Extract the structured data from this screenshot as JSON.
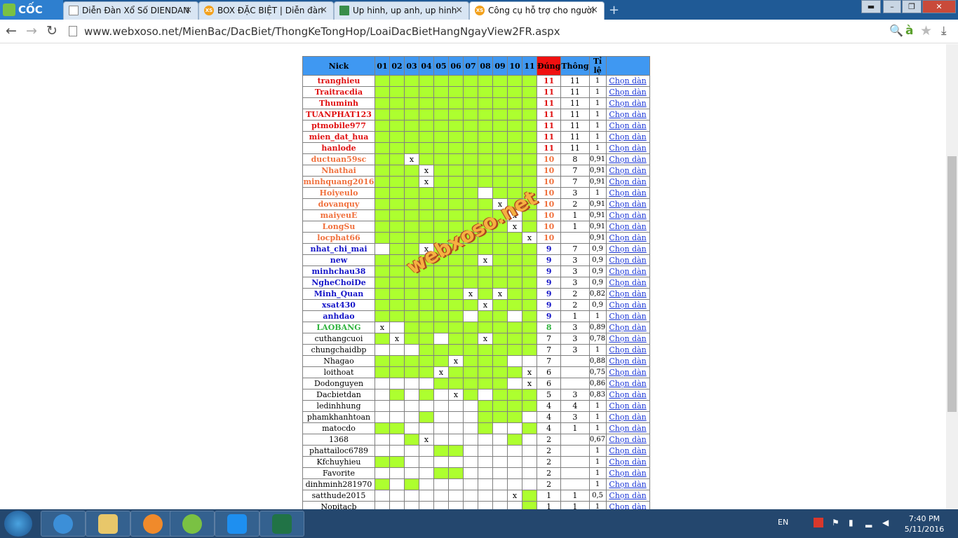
{
  "browser": {
    "logo": "CỐC CỐC",
    "tabs": [
      {
        "label": "Diễn Đàn Xổ Số DIENDAN",
        "icon": "document-icon"
      },
      {
        "label": "BOX ĐẶC BIỆT | Diễn đàn",
        "icon": "xs-icon",
        "icon_text": "XS"
      },
      {
        "label": "Up hinh, up anh, up hinh",
        "icon": "image-icon"
      },
      {
        "label": "Công cụ hỗ trợ cho người",
        "icon": "xs-icon",
        "icon_text": "XS",
        "active": true
      }
    ],
    "url": "www.webxoso.net/MienBac/DacBiet/ThongKeTongHop/LoaiDacBietHangNgayView2FR.aspx"
  },
  "table": {
    "headers": {
      "nick": "Nick",
      "days": [
        "01",
        "02",
        "03",
        "04",
        "05",
        "06",
        "07",
        "08",
        "09",
        "10",
        "11"
      ],
      "dung": "Đúng",
      "thong": "Thông",
      "tile": "Tỉ lệ"
    },
    "link_label": "Chọn dàn",
    "rows": [
      {
        "nick": "tranghieu",
        "color": "red",
        "cells": "ggggggggggg",
        "x": [],
        "dung": "11",
        "thong": "11",
        "tile": "1"
      },
      {
        "nick": "Traitracdia",
        "color": "red",
        "cells": "ggggggggggg",
        "x": [],
        "dung": "11",
        "thong": "11",
        "tile": "1"
      },
      {
        "nick": "Thuminh",
        "color": "red",
        "cells": "ggggggggggg",
        "x": [],
        "dung": "11",
        "thong": "11",
        "tile": "1"
      },
      {
        "nick": "TUANPHAT123",
        "color": "red",
        "cells": "ggggggggggg",
        "x": [],
        "dung": "11",
        "thong": "11",
        "tile": "1"
      },
      {
        "nick": "ptmobile977",
        "color": "red",
        "cells": "ggggggggggg",
        "x": [],
        "dung": "11",
        "thong": "11",
        "tile": "1"
      },
      {
        "nick": "mien_dat_hua",
        "color": "red",
        "cells": "ggggggggggg",
        "x": [],
        "dung": "11",
        "thong": "11",
        "tile": "1"
      },
      {
        "nick": "hanlode",
        "color": "red",
        "cells": "ggggggggggg",
        "x": [],
        "dung": "11",
        "thong": "11",
        "tile": "1"
      },
      {
        "nick": "ductuan59sc",
        "color": "orange",
        "cells": "ggwgggggggg",
        "x": [
          3
        ],
        "dung": "10",
        "thong": "8",
        "tile": "0,91"
      },
      {
        "nick": "Nhathai",
        "color": "orange",
        "cells": "gggwggggggg",
        "x": [
          4
        ],
        "dung": "10",
        "thong": "7",
        "tile": "0,91"
      },
      {
        "nick": "minhquang2016",
        "color": "orange",
        "cells": "gggwggggggg",
        "x": [
          4
        ],
        "dung": "10",
        "thong": "7",
        "tile": "0,91"
      },
      {
        "nick": "Hoiyeulo",
        "color": "orange",
        "cells": "gggggggwggg",
        "x": [],
        "dung": "10",
        "thong": "3",
        "tile": "1"
      },
      {
        "nick": "dovanquy",
        "color": "orange",
        "cells": "ggggggggwgg",
        "x": [
          9
        ],
        "dung": "10",
        "thong": "2",
        "tile": "0,91"
      },
      {
        "nick": "maiyeuE",
        "color": "orange",
        "cells": "gggggggggwg",
        "x": [
          10
        ],
        "dung": "10",
        "thong": "1",
        "tile": "0,91"
      },
      {
        "nick": "LongSu",
        "color": "orange",
        "cells": "gggggggggwg",
        "x": [
          10
        ],
        "dung": "10",
        "thong": "1",
        "tile": "0,91"
      },
      {
        "nick": "locphat66",
        "color": "orange",
        "cells": "ggggggggggw",
        "x": [
          11
        ],
        "dung": "10",
        "thong": "",
        "tile": "0,91"
      },
      {
        "nick": "nhat_chi_mai",
        "color": "blue",
        "cells": "wggwggggggg",
        "x": [
          4
        ],
        "dung": "9",
        "thong": "7",
        "tile": "0,9"
      },
      {
        "nick": "new",
        "color": "blue",
        "cells": "gggggggwggg",
        "x": [
          8
        ],
        "dung": "9",
        "thong": "3",
        "tile": "0,9"
      },
      {
        "nick": "minhchau38",
        "color": "blue",
        "cells": "ggggggggggg",
        "x": [],
        "dung": "9",
        "thong": "3",
        "tile": "0,9"
      },
      {
        "nick": "NgheChoiDe",
        "color": "blue",
        "cells": "ggggggggggg",
        "x": [],
        "dung": "9",
        "thong": "3",
        "tile": "0,9"
      },
      {
        "nick": "Minh_Quan",
        "color": "blue",
        "cells": "ggggggwgwgg",
        "x": [
          7,
          9
        ],
        "dung": "9",
        "thong": "2",
        "tile": "0,82"
      },
      {
        "nick": "xsat430",
        "color": "blue",
        "cells": "gggggggwggg",
        "x": [
          8
        ],
        "dung": "9",
        "thong": "2",
        "tile": "0,9"
      },
      {
        "nick": "anhdao",
        "color": "blue",
        "cells": "ggggggwggwg",
        "x": [],
        "dung": "9",
        "thong": "1",
        "tile": "1"
      },
      {
        "nick": "LAOBANG",
        "color": "green",
        "cells": "wwggggggggg",
        "x": [
          1
        ],
        "dung": "8",
        "thong": "3",
        "tile": "0,89"
      },
      {
        "nick": "cuthangcuoi",
        "color": "black",
        "cells": "gwggwggwggg",
        "x": [
          2,
          8
        ],
        "dung": "7",
        "thong": "3",
        "tile": "0,78"
      },
      {
        "nick": "chungchaidbp",
        "color": "black",
        "cells": "wwwgggggggg",
        "x": [],
        "dung": "7",
        "thong": "3",
        "tile": "1"
      },
      {
        "nick": "Nhagao",
        "color": "black",
        "cells": "gggggwgggww",
        "x": [
          6
        ],
        "dung": "7",
        "thong": "",
        "tile": "0,88"
      },
      {
        "nick": "loithoat",
        "color": "black",
        "cells": "ggggwgggggw",
        "x": [
          5,
          11
        ],
        "dung": "6",
        "thong": "",
        "tile": "0,75"
      },
      {
        "nick": "Dodonguyen",
        "color": "black",
        "cells": "wwwwgggggww",
        "x": [
          11
        ],
        "dung": "6",
        "thong": "",
        "tile": "0,86"
      },
      {
        "nick": "Dacbietdan",
        "color": "black",
        "cells": "wgwgwwgwggg",
        "x": [
          6
        ],
        "dung": "5",
        "thong": "3",
        "tile": "0,83"
      },
      {
        "nick": "ledinhhung",
        "color": "black",
        "cells": "wwwwwwwgggg",
        "x": [],
        "dung": "4",
        "thong": "4",
        "tile": "1"
      },
      {
        "nick": "phamkhanhtoan",
        "color": "black",
        "cells": "wwwgwwwgggw",
        "x": [],
        "dung": "4",
        "thong": "3",
        "tile": "1"
      },
      {
        "nick": "matocdo",
        "color": "black",
        "cells": "ggwwwwwgwwg",
        "x": [],
        "dung": "4",
        "thong": "1",
        "tile": "1"
      },
      {
        "nick": "1368",
        "color": "black",
        "cells": "wwgwwwwwwgw",
        "x": [
          4
        ],
        "dung": "2",
        "thong": "",
        "tile": "0,67"
      },
      {
        "nick": "phattailoc6789",
        "color": "black",
        "cells": "wwwwggwwwww",
        "x": [],
        "dung": "2",
        "thong": "",
        "tile": "1"
      },
      {
        "nick": "Kfchuyhieu",
        "color": "black",
        "cells": "ggwwwwwwwww",
        "x": [],
        "dung": "2",
        "thong": "",
        "tile": "1"
      },
      {
        "nick": "Favorite",
        "color": "black",
        "cells": "wwwwggwwwww",
        "x": [],
        "dung": "2",
        "thong": "",
        "tile": "1"
      },
      {
        "nick": "dinhminh281970",
        "color": "black",
        "cells": "gwgwwwwwwww",
        "x": [],
        "dung": "2",
        "thong": "",
        "tile": "1"
      },
      {
        "nick": "satthude2015",
        "color": "black",
        "cells": "wwwwwwwwwwg",
        "x": [
          10
        ],
        "dung": "1",
        "thong": "1",
        "tile": "0,5"
      },
      {
        "nick": "Nopitacb",
        "color": "black",
        "cells": "wwwwwwwwwwg",
        "x": [],
        "dung": "1",
        "thong": "1",
        "tile": "1"
      }
    ]
  },
  "watermark": "webxoso.net",
  "taskbar": {
    "lang": "EN",
    "time": "7:40 PM",
    "date": "5/11/2016"
  },
  "colors": {
    "green_cell": "#adff2f",
    "header": "#3f98f2",
    "dung_header": "#f01010"
  }
}
